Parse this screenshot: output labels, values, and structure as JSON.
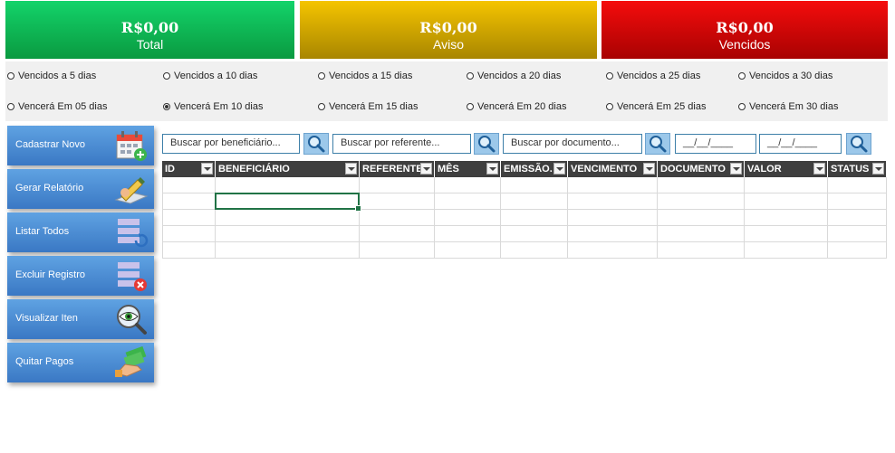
{
  "cards": [
    {
      "amount": "R$0,00",
      "label": "Total"
    },
    {
      "amount": "R$0,00",
      "label": "Aviso"
    },
    {
      "amount": "R$0,00",
      "label": "Vencidos"
    }
  ],
  "filters": {
    "row1": [
      "Vencidos a 5 dias",
      "Vencidos a 10 dias",
      "Vencidos a 15 dias",
      "Vencidos a 20 dias",
      "Vencidos a 25 dias",
      "Vencidos a 30 dias"
    ],
    "row2": [
      "Vencerá Em 05 dias",
      "Vencerá Em 10 dias",
      "Vencerá Em 15 dias",
      "Vencerá Em 20 dias",
      "Vencerá Em 25 dias",
      "Vencerá Em 30 dias"
    ],
    "selected": "Vencerá Em 10 dias"
  },
  "sidebar": {
    "buttons": [
      {
        "label": "Cadastrar Novo",
        "icon": "calendar-add-icon"
      },
      {
        "label": "Gerar Relatório",
        "icon": "pen-document-icon"
      },
      {
        "label": "Listar Todos",
        "icon": "list-refresh-icon"
      },
      {
        "label": "Excluir Registro",
        "icon": "list-delete-icon"
      },
      {
        "label": "Visualizar Iten",
        "icon": "eye-magnifier-icon"
      },
      {
        "label": "Quitar Pagos",
        "icon": "money-hand-icon"
      }
    ]
  },
  "search": {
    "beneficiario": "Buscar por beneficiário...",
    "referente": "Buscar por referente...",
    "documento": "Buscar por documento...",
    "date_from": "__/__/____",
    "date_to": "__/__/____",
    "icon": "search-icon"
  },
  "table": {
    "columns": [
      "ID",
      "BENEFICIÁRIO",
      "REFERENTE",
      "MÊS",
      "EMISSÃO.",
      "VENCIMENTO",
      "DOCUMENTO",
      "VALOR",
      "STATUS"
    ],
    "rows": [
      [
        "",
        "",
        "",
        "",
        "",
        "",
        "",
        "",
        ""
      ],
      [
        "",
        "",
        "",
        "",
        "",
        "",
        "",
        "",
        ""
      ],
      [
        "",
        "",
        "",
        "",
        "",
        "",
        "",
        "",
        ""
      ],
      [
        "",
        "",
        "",
        "",
        "",
        "",
        "",
        "",
        ""
      ],
      [
        "",
        "",
        "",
        "",
        "",
        "",
        "",
        "",
        ""
      ]
    ]
  },
  "colors": {
    "green": "#0fb554",
    "yellow": "#d9ac00",
    "red": "#d80606",
    "button": "#4a8ad6",
    "header": "#3f3f3f"
  }
}
